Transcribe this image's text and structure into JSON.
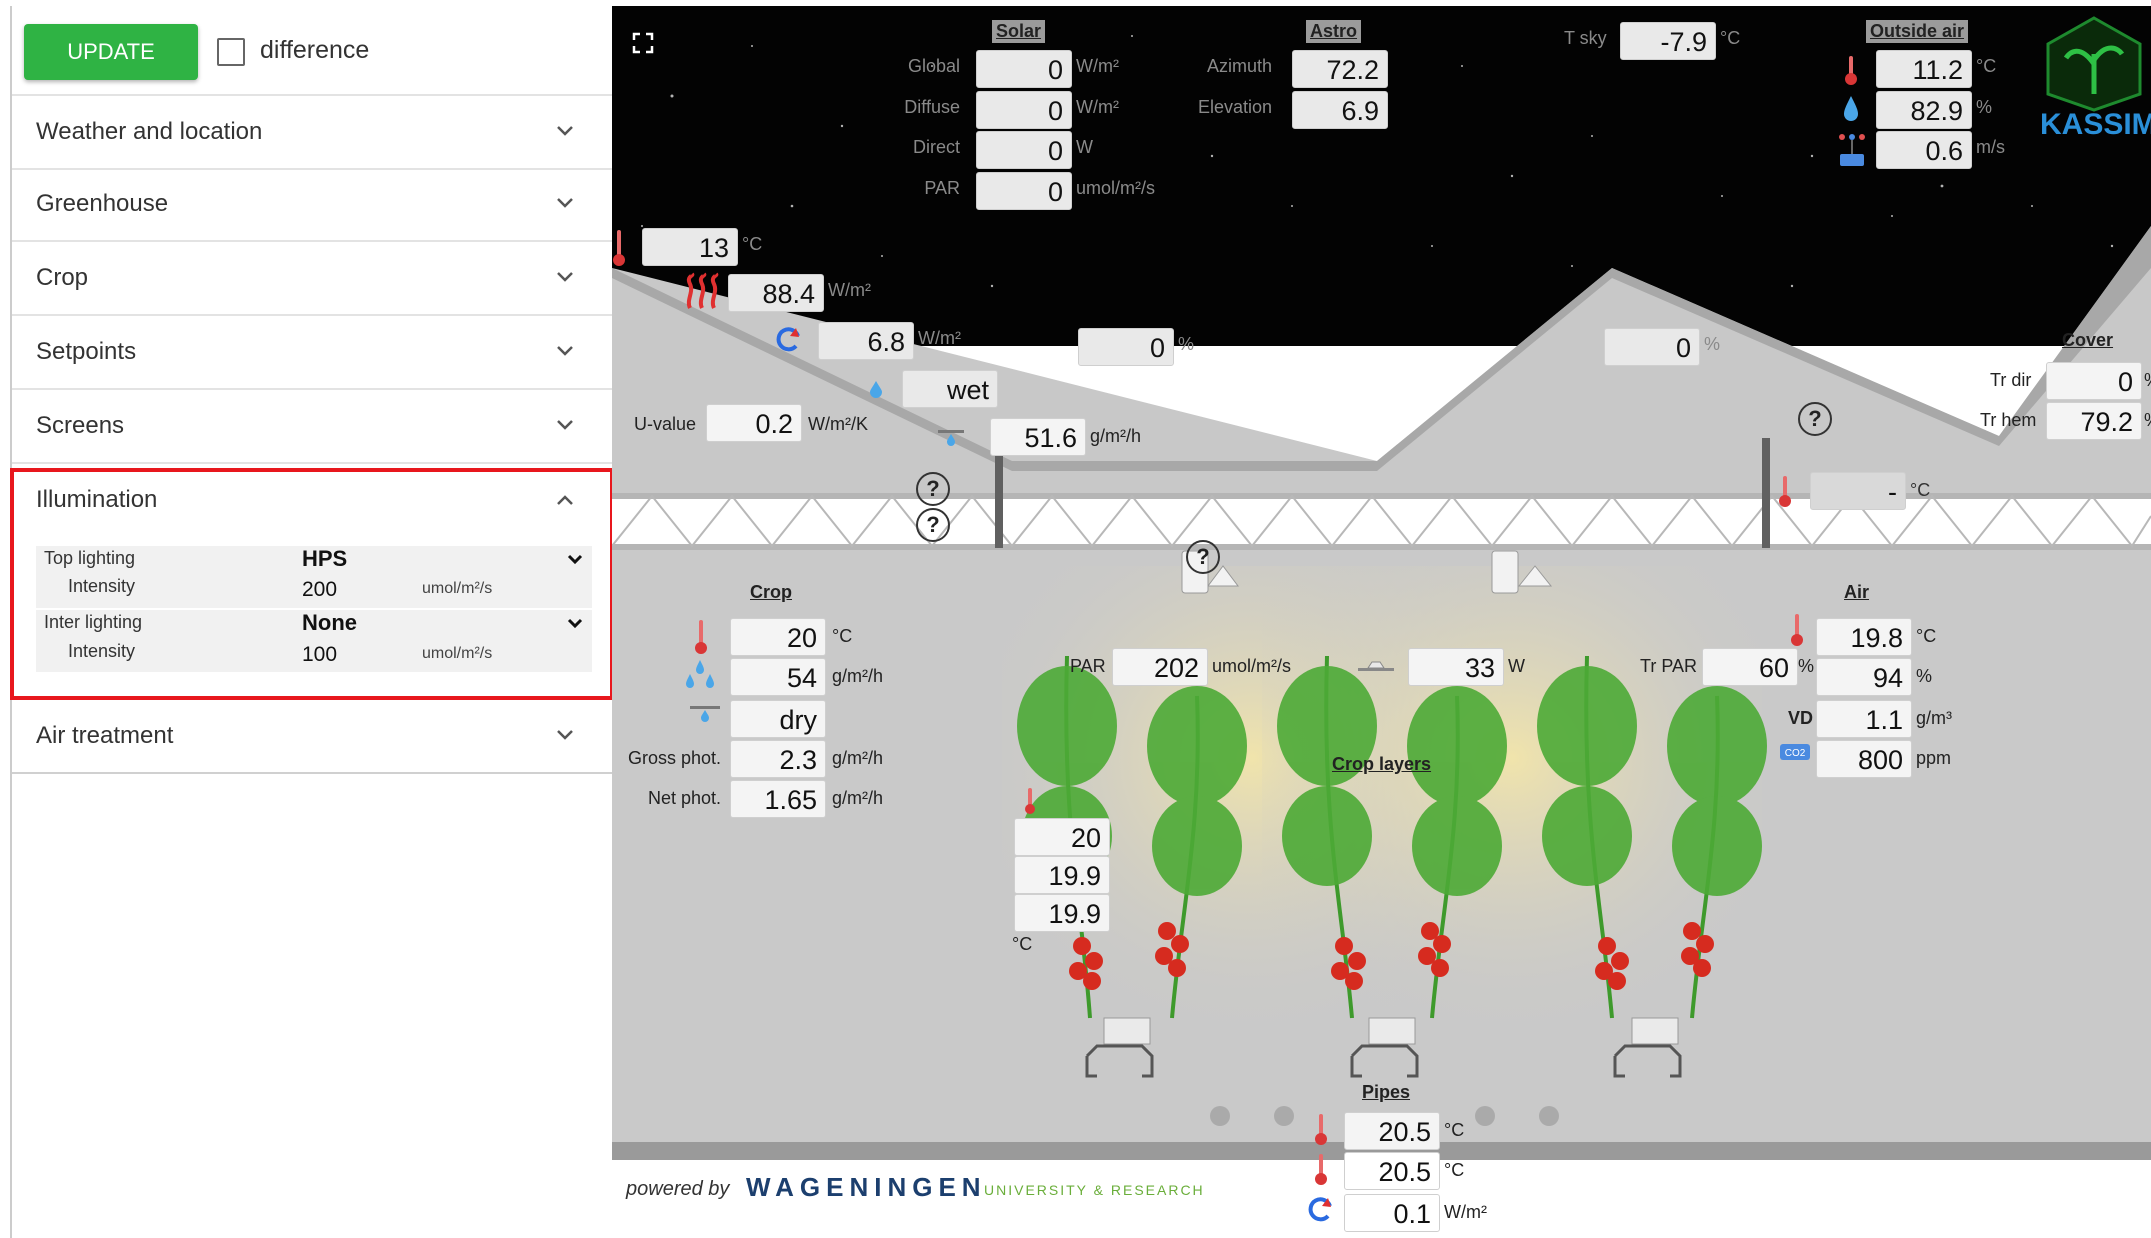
{
  "toolbar": {
    "update_label": "UPDATE",
    "difference_label": "difference"
  },
  "sidebar": {
    "sections": {
      "weather": "Weather and location",
      "greenhouse": "Greenhouse",
      "crop": "Crop",
      "setpoints": "Setpoints",
      "screens": "Screens",
      "illumination": "Illumination",
      "air_treatment": "Air treatment"
    },
    "illumination": {
      "top_lighting_label": "Top lighting",
      "top_lighting_value": "HPS",
      "top_intensity_label": "Intensity",
      "top_intensity_value": "200",
      "top_intensity_unit": "umol/m²/s",
      "inter_lighting_label": "Inter lighting",
      "inter_lighting_value": "None",
      "inter_intensity_label": "Intensity",
      "inter_intensity_value": "100",
      "inter_intensity_unit": "umol/m²/s"
    }
  },
  "scene": {
    "solar": {
      "header": "Solar",
      "global_label": "Global",
      "global_value": "0",
      "global_unit": "W/m²",
      "diffuse_label": "Diffuse",
      "diffuse_value": "0",
      "diffuse_unit": "W/m²",
      "direct_label": "Direct",
      "direct_value": "0",
      "direct_unit": "W",
      "par_label": "PAR",
      "par_value": "0",
      "par_unit": "umol/m²/s"
    },
    "astro": {
      "header": "Astro",
      "azimuth_label": "Azimuth",
      "azimuth_value": "72.2",
      "elevation_label": "Elevation",
      "elevation_value": "6.9"
    },
    "tsky": {
      "label": "T sky",
      "value": "-7.9",
      "unit": "°C"
    },
    "outside_air": {
      "header": "Outside air",
      "temp_value": "11.2",
      "temp_unit": "°C",
      "rh_value": "82.9",
      "rh_unit": "%",
      "wind_value": "0.6",
      "wind_unit": "m/s"
    },
    "logo_text": "KASSIM",
    "roof": {
      "temp_value": "13",
      "temp_unit": "°C",
      "heat_value": "88.4",
      "heat_unit": "W/m²",
      "rad_value": "6.8",
      "rad_unit": "W/m²",
      "cond_value": "wet",
      "uvalue_label": "U-value",
      "uvalue_value": "0.2",
      "uvalue_unit": "W/m²/K",
      "condflux_value": "51.6",
      "condflux_unit": "g/m²/h",
      "vent1_value": "0",
      "vent1_unit": "%",
      "vent2_value": "0",
      "vent2_unit": "%"
    },
    "cover": {
      "header": "Cover",
      "trdir_label": "Tr dir",
      "trdir_value": "0",
      "trdir_unit": "%",
      "trhem_label": "Tr hem",
      "trhem_value": "79.2",
      "trhem_unit": "%"
    },
    "screen_temp": {
      "value": "-",
      "unit": "°C"
    },
    "crop": {
      "header": "Crop",
      "temp_value": "20",
      "temp_unit": "°C",
      "trans_value": "54",
      "trans_unit": "g/m²/h",
      "surface_value": "dry",
      "gross_label": "Gross phot.",
      "gross_value": "2.3",
      "gross_unit": "g/m²/h",
      "net_label": "Net phot.",
      "net_value": "1.65",
      "net_unit": "g/m²/h",
      "layers_label": "Crop layers",
      "layer_temps": [
        "20",
        "19.9",
        "19.9"
      ],
      "layer_unit": "°C"
    },
    "par": {
      "label": "PAR",
      "value": "202",
      "unit": "umol/m²/s"
    },
    "lamp": {
      "value": "33",
      "unit": "W"
    },
    "trpar": {
      "label": "Tr PAR",
      "value": "60",
      "unit": "%"
    },
    "air": {
      "header": "Air",
      "temp_value": "19.8",
      "temp_unit": "°C",
      "rh_value": "94",
      "rh_unit": "%",
      "vd_label": "VD",
      "vd_value": "1.1",
      "vd_unit": "g/m³",
      "co2_value": "800",
      "co2_unit": "ppm"
    },
    "pipes": {
      "header": "Pipes",
      "t1_value": "20.5",
      "t1_unit": "°C",
      "t2_value": "20.5",
      "t2_unit": "°C",
      "rad_value": "0.1",
      "rad_unit": "W/m²"
    },
    "footer": {
      "powered_by": "powered by",
      "brand": "WAGENINGEN",
      "brand_sub": "UNIVERSITY & RESEARCH"
    },
    "colors": {
      "accent_green": "#2fb344",
      "highlight_red": "#e8171d",
      "logo_green": "#1e8a2e",
      "kassim_blue": "#2a8fd8"
    }
  }
}
